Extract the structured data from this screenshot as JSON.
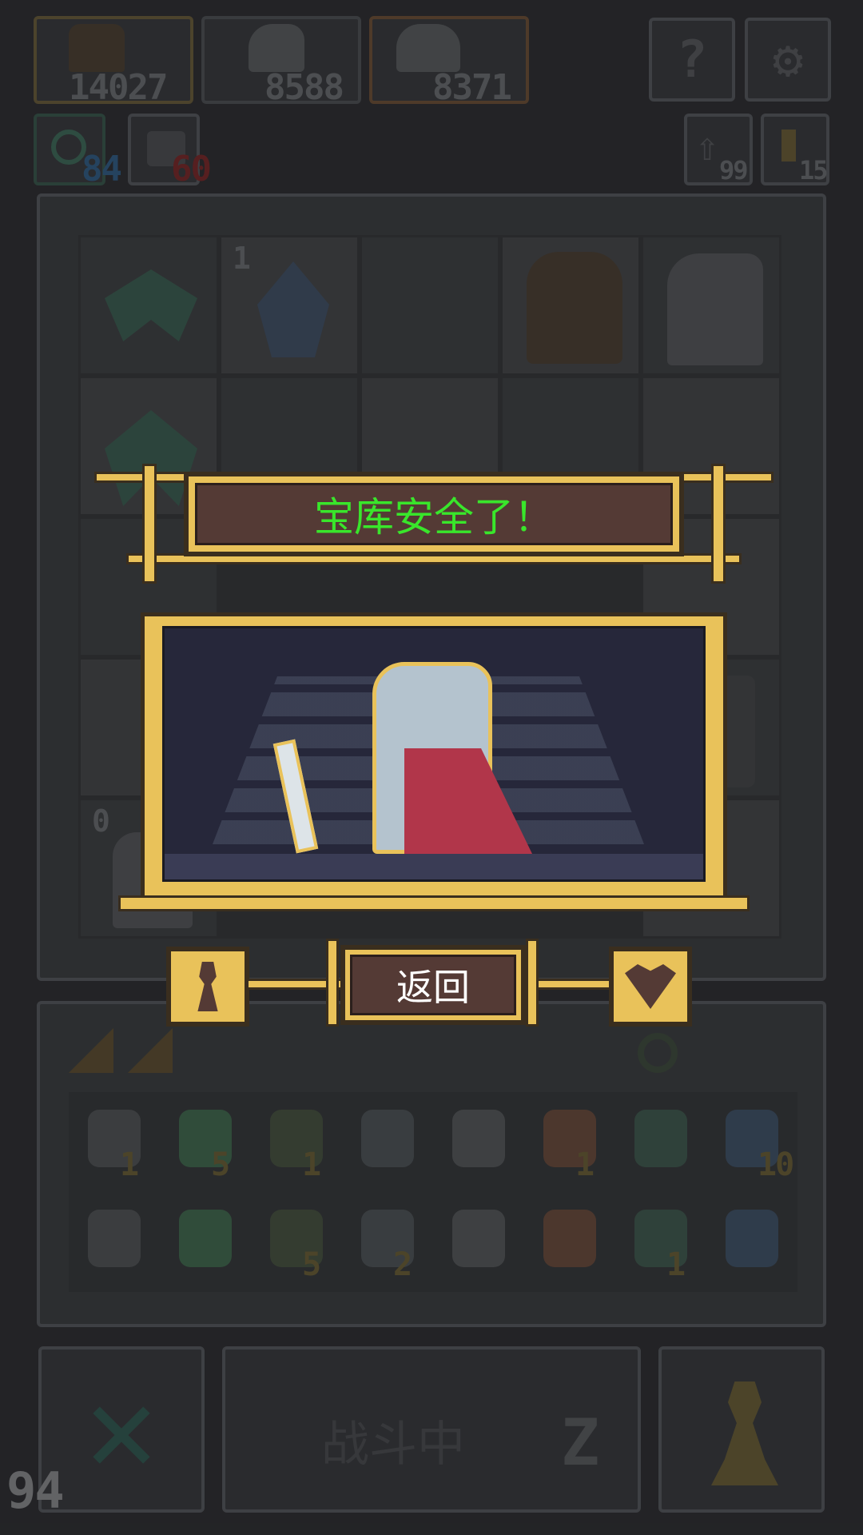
{
  "top_bar": {
    "heroes": [
      {
        "icon": "brute-hero-icon",
        "score": "14027"
      },
      {
        "icon": "thief-hero-icon",
        "score": "8588"
      },
      {
        "icon": "knight-hero-icon",
        "score": "8371"
      }
    ],
    "help_icon": "question-mark-icon",
    "settings_icon": "gear-icon",
    "currencies": [
      {
        "icon": "target-icon",
        "value": "84",
        "color": "#2e5d86"
      },
      {
        "icon": "dice-icon",
        "value": "60",
        "color": "#7a2626"
      }
    ],
    "right_counters": [
      {
        "icon": "return-arrow-icon",
        "value": "99"
      },
      {
        "icon": "key-icon",
        "value": "15"
      }
    ]
  },
  "board": {
    "tiles": [
      {
        "icon": "green-spider-icon"
      },
      {
        "icon": "blue-crystal-icon",
        "badge": "1"
      },
      {
        "icon": "empty-slot"
      },
      {
        "icon": "brute-hero-icon"
      },
      {
        "icon": "skeleton-knight-icon"
      }
    ],
    "badge_left": "0"
  },
  "dialog": {
    "title": "宝库安全了！",
    "title_color": "#39e62b",
    "return_label": "返回",
    "left_icon": "pawn-icon",
    "right_icon": "heart-shield-icon"
  },
  "inventory": {
    "row1": [
      {
        "icon": "scroll-icon",
        "count": "1"
      },
      {
        "icon": "green-shield-icon",
        "count": "5"
      },
      {
        "icon": "goblin-icon",
        "count": "1"
      },
      {
        "icon": "rock-icon",
        "count": ""
      },
      {
        "icon": "dagger-icon",
        "count": ""
      },
      {
        "icon": "fire-imp-icon",
        "count": "1"
      },
      {
        "icon": "green-glove-icon",
        "count": ""
      },
      {
        "icon": "blue-potion-icon",
        "count": "10"
      }
    ],
    "row2": [
      {
        "icon": "curved-blade-icon",
        "count": ""
      },
      {
        "icon": "chest-icon",
        "count": ""
      },
      {
        "icon": "flower-icon",
        "count": "5"
      },
      {
        "icon": "bust-icon",
        "count": "2"
      },
      {
        "icon": "swirl-icon",
        "count": ""
      },
      {
        "icon": "basket-icon",
        "count": ""
      },
      {
        "icon": "cloud-icon",
        "count": "1"
      },
      {
        "icon": "orb-icon",
        "count": ""
      }
    ]
  },
  "bottom": {
    "cancel_icon": "x-icon",
    "battle_label": "战斗中",
    "sleep_icon": "z-icon",
    "hero_icon": "pawn-icon",
    "fps": "94"
  }
}
